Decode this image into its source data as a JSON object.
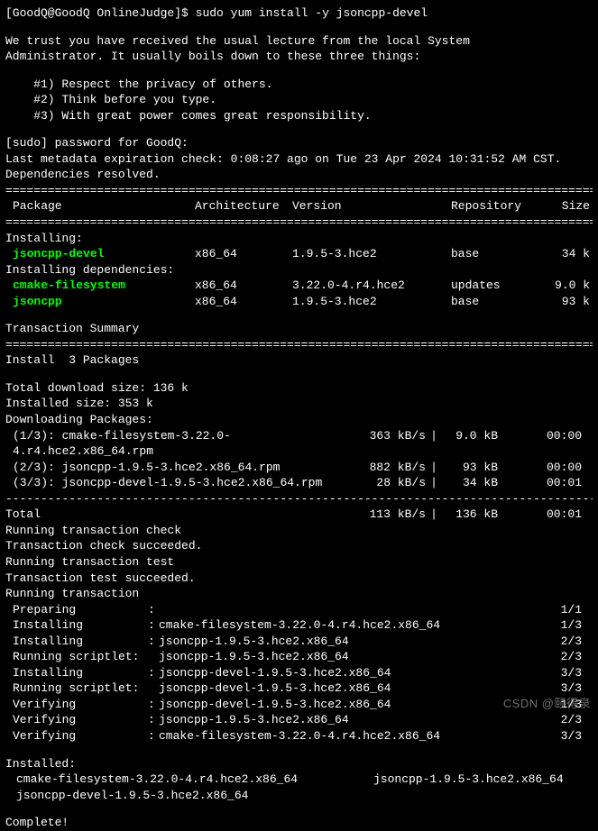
{
  "prompt": "[GoodQ@GoodQ OnlineJudge]$ ",
  "command": "sudo yum install -y jsoncpp-devel",
  "sudo_lecture": {
    "line1": "We trust you have received the usual lecture from the local System",
    "line2": "Administrator. It usually boils down to these three things:",
    "item1": "    #1) Respect the privacy of others.",
    "item2": "    #2) Think before you type.",
    "item3": "    #3) With great power comes great responsibility."
  },
  "password_prompt": "[sudo] password for GoodQ:",
  "metadata_line": "Last metadata expiration check: 0:08:27 ago on Tue 23 Apr 2024 10:31:52 AM CST.",
  "deps_resolved": "Dependencies resolved.",
  "table": {
    "headers": {
      "pkg": "Package",
      "arch": "Architecture",
      "ver": "Version",
      "repo": "Repository",
      "size": "Size"
    },
    "installing_label": "Installing:",
    "installing_deps_label": "Installing dependencies:",
    "rows": [
      {
        "pkg": "jsoncpp-devel",
        "arch": "x86_64",
        "ver": "1.9.5-3.hce2",
        "repo": "base",
        "size": "34 k"
      },
      {
        "pkg": "cmake-filesystem",
        "arch": "x86_64",
        "ver": "3.22.0-4.r4.hce2",
        "repo": "updates",
        "size": "9.0 k"
      },
      {
        "pkg": "jsoncpp",
        "arch": "x86_64",
        "ver": "1.9.5-3.hce2",
        "repo": "base",
        "size": "93 k"
      }
    ]
  },
  "tx_summary_label": "Transaction Summary",
  "install_count": "Install  3 Packages",
  "total_dl": "Total download size: 136 k",
  "installed_size": "Installed size: 353 k",
  "downloading_label": "Downloading Packages:",
  "downloads": [
    {
      "name": "(1/3): cmake-filesystem-3.22.0-4.r4.hce2.x86_64.rpm",
      "speed": "363 kB/s",
      "size": "9.0 kB",
      "time": "00:00"
    },
    {
      "name": "(2/3): jsoncpp-1.9.5-3.hce2.x86_64.rpm",
      "speed": "882 kB/s",
      "size": "93 kB",
      "time": "00:00"
    },
    {
      "name": "(3/3): jsoncpp-devel-1.9.5-3.hce2.x86_64.rpm",
      "speed": "28 kB/s",
      "size": "34 kB",
      "time": "00:01"
    }
  ],
  "total_row": {
    "name": "Total",
    "speed": "113 kB/s",
    "size": "136 kB",
    "time": "00:01"
  },
  "tx_steps": {
    "check": "Running transaction check",
    "check_ok": "Transaction check succeeded.",
    "test": "Running transaction test",
    "test_ok": "Transaction test succeeded.",
    "run": "Running transaction"
  },
  "tx_rows": [
    {
      "label": "Preparing",
      "pkg": "",
      "count": "1/1"
    },
    {
      "label": "Installing",
      "pkg": "cmake-filesystem-3.22.0-4.r4.hce2.x86_64",
      "count": "1/3"
    },
    {
      "label": "Installing",
      "pkg": "jsoncpp-1.9.5-3.hce2.x86_64",
      "count": "2/3"
    },
    {
      "label": "Running scriptlet:",
      "pkg": "jsoncpp-1.9.5-3.hce2.x86_64",
      "count": "2/3"
    },
    {
      "label": "Installing",
      "pkg": "jsoncpp-devel-1.9.5-3.hce2.x86_64",
      "count": "3/3"
    },
    {
      "label": "Running scriptlet:",
      "pkg": "jsoncpp-devel-1.9.5-3.hce2.x86_64",
      "count": "3/3"
    },
    {
      "label": "Verifying",
      "pkg": "jsoncpp-devel-1.9.5-3.hce2.x86_64",
      "count": "1/3"
    },
    {
      "label": "Verifying",
      "pkg": "jsoncpp-1.9.5-3.hce2.x86_64",
      "count": "2/3"
    },
    {
      "label": "Verifying",
      "pkg": "cmake-filesystem-3.22.0-4.r4.hce2.x86_64",
      "count": "3/3"
    }
  ],
  "installed_label": "Installed:",
  "installed_pkgs": {
    "a": "cmake-filesystem-3.22.0-4.r4.hce2.x86_64",
    "b": "jsoncpp-1.9.5-3.hce2.x86_64",
    "c": "jsoncpp-devel-1.9.5-3.hce2.x86_64"
  },
  "complete": "Complete!",
  "hr_thick": "================================================================================================",
  "hr_thin": "------------------------------------------------------------------------------------------------",
  "watermark": "CSDN @颐得泉"
}
